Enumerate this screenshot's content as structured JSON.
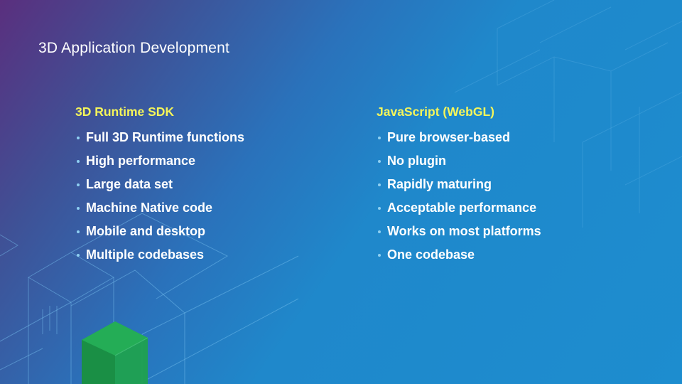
{
  "slide": {
    "title": "3D Application Development",
    "columns": [
      {
        "heading": "3D Runtime SDK",
        "items": [
          "Full 3D Runtime functions",
          "High performance",
          "Large data set",
          "Machine Native code",
          "Mobile and desktop",
          "Multiple codebases"
        ]
      },
      {
        "heading": "JavaScript (WebGL)",
        "items": [
          "Pure browser-based",
          "No plugin",
          "Rapidly maturing",
          "Acceptable performance",
          "Works on most platforms",
          "One codebase"
        ]
      }
    ]
  },
  "colors": {
    "heading": "#f5f55a",
    "text": "#ffffff",
    "bullet": "#8fd0f2",
    "cube": "#1fa14f"
  }
}
